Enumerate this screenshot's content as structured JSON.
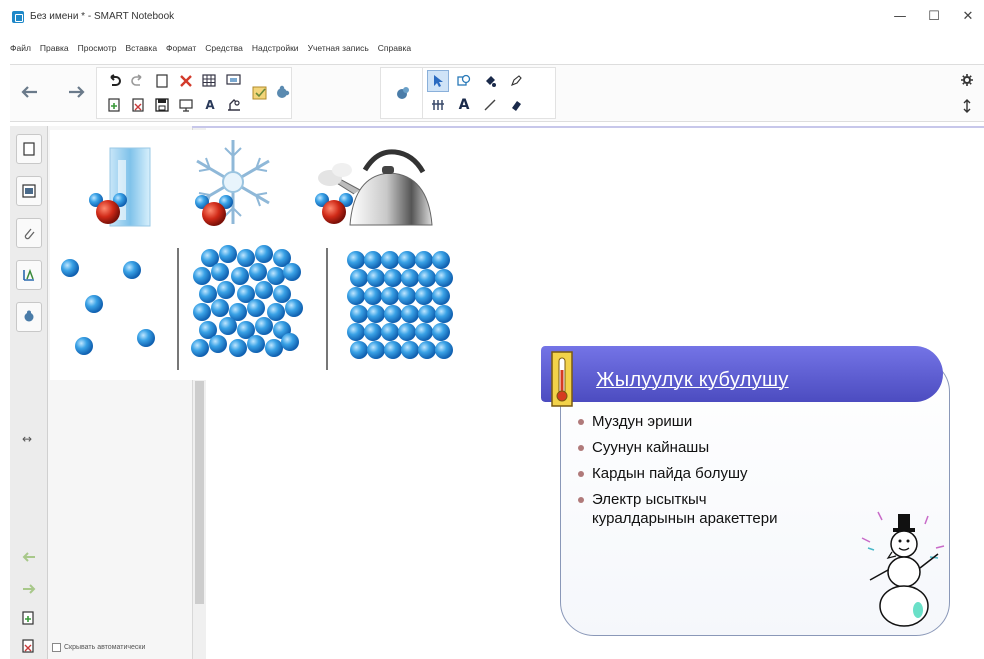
{
  "window": {
    "title": "Без имени * - SMART Notebook",
    "minimize_glyph": "—",
    "maximize_glyph": "☐",
    "close_glyph": "✕"
  },
  "menu": {
    "items": [
      {
        "label": "Файл"
      },
      {
        "label": "Правка"
      },
      {
        "label": "Просмотр"
      },
      {
        "label": "Вставка"
      },
      {
        "label": "Формат"
      },
      {
        "label": "Средства"
      },
      {
        "label": "Надстройки"
      },
      {
        "label": "Учетная запись"
      },
      {
        "label": "Справка"
      }
    ]
  },
  "toolbar": {
    "back_icon": "arrow-left-icon",
    "forward_icon": "arrow-right-icon",
    "text_tool_glyph": "A",
    "text_tool_glyph2": "A"
  },
  "sidebar": {
    "resize_glyph": "↔",
    "autohide_label": "Скрывать автоматически"
  },
  "card": {
    "title": "Жылуулук кубулушу",
    "items": [
      {
        "text": "Муздун эриши"
      },
      {
        "text": "Суунун кайнашы"
      },
      {
        "text": "Кардын пайда болушу"
      },
      {
        "text": "Электр ысыткыч куралдарынын аракеттери"
      }
    ]
  },
  "colors": {
    "card_header": "#5a5ad0",
    "molecule_blue": "#3a9bde",
    "molecule_red": "#c42a1c"
  }
}
